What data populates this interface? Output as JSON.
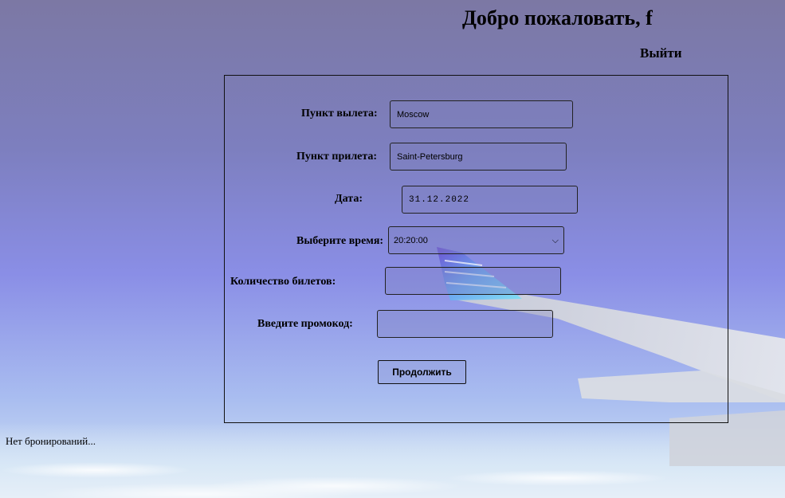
{
  "header": {
    "welcome": "Добро пожаловать, f",
    "logout": "Выйти"
  },
  "form": {
    "departure": {
      "label": "Пункт вылета:",
      "value": "Moscow"
    },
    "arrival": {
      "label": "Пункт прилета:",
      "value": "Saint-Petersburg"
    },
    "date": {
      "label": "Дата:",
      "value": "31.12.2022"
    },
    "time": {
      "label": "Выберите время:",
      "value": "20:20:00"
    },
    "tickets": {
      "label": "Количество билетов:",
      "value": ""
    },
    "promo": {
      "label": "Введите промокод:",
      "value": ""
    },
    "submit": "Продолжить"
  },
  "bookings": {
    "empty_text": "Нет бронирований..."
  },
  "colors": {
    "background_top": "#7c78a4",
    "background_bottom": "#d6e6f4"
  }
}
